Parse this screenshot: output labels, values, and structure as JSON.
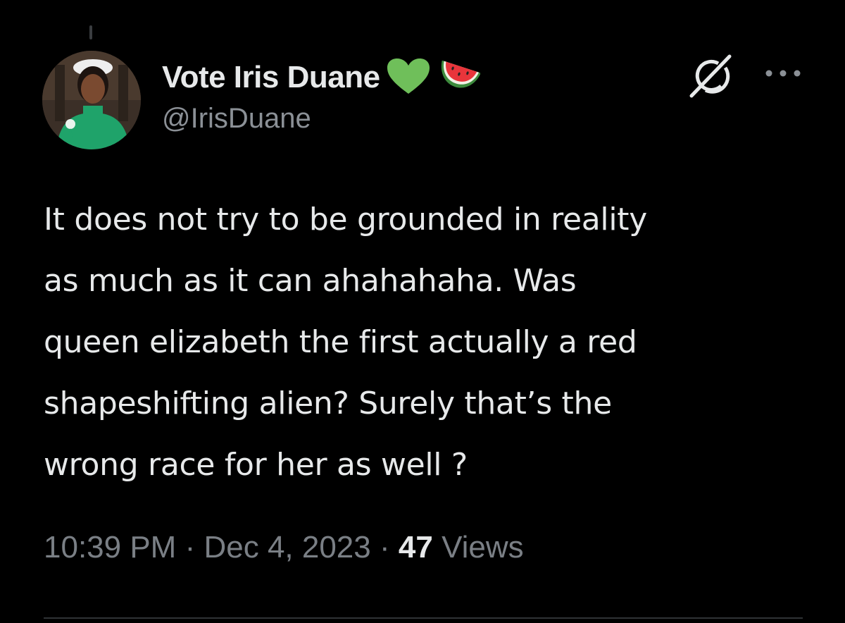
{
  "tweet": {
    "author": {
      "display_name": "Vote Iris Duane",
      "handle": "@IrisDuane",
      "name_emojis": [
        "green-heart-icon",
        "watermelon-icon"
      ]
    },
    "text": "It does not try to be grounded in reality\nas much as it can ahahahaha. Was\nqueen elizabeth the first actually a red\nshapeshifting alien? Surely that’s the\nwrong race for her as well ?",
    "time": "10:39 PM",
    "separator": "·",
    "date": "Dec 4, 2023",
    "views_count": "47",
    "views_label": "Views"
  },
  "icons": {
    "grok": "grok-icon",
    "more": "more-options-icon"
  },
  "colors": {
    "background": "#000000",
    "primary_text": "#e7e9ea",
    "secondary_text": "#7a7f85",
    "heart_green": "#6fbf5a"
  }
}
